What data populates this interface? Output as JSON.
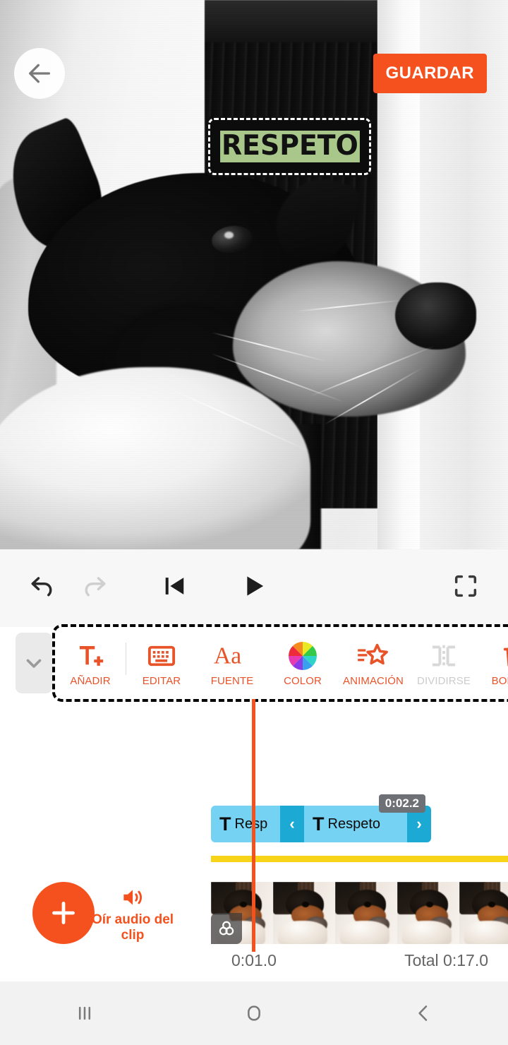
{
  "header": {
    "back_icon": "arrow-left-icon",
    "save_label": "GUARDAR"
  },
  "preview": {
    "overlay_text": "RESPETO",
    "overlay_text_color": "#111111",
    "overlay_highlight_color": "#a9c68b",
    "overlay_background_color": "#0c0c0c"
  },
  "playback": {
    "undo_icon": "undo-icon",
    "redo_icon": "redo-icon",
    "skip_start_icon": "skip-to-start-icon",
    "play_icon": "play-icon",
    "fullscreen_icon": "fullscreen-icon"
  },
  "toolbar": {
    "collapse_icon": "chevron-down-icon",
    "items": [
      {
        "label": "AÑADIR",
        "icon": "text-add-icon",
        "disabled": false
      },
      {
        "label": "EDITAR",
        "icon": "keyboard-icon",
        "disabled": false
      },
      {
        "label": "FUENTE",
        "icon": "font-aa-icon",
        "disabled": false
      },
      {
        "label": "COLOR",
        "icon": "color-wheel-icon",
        "disabled": false
      },
      {
        "label": "ANIMACIÓN",
        "icon": "star-motion-icon",
        "disabled": false
      },
      {
        "label": "DIVIDIRSE",
        "icon": "split-icon",
        "disabled": true
      },
      {
        "label": "BORRAR",
        "icon": "trash-icon",
        "disabled": false
      }
    ]
  },
  "timeline": {
    "text_clips": [
      {
        "t_icon": "text-T-icon",
        "name": "Resp"
      },
      {
        "t_icon": "text-T-icon",
        "name": "Respeto",
        "duration": "0:02.2",
        "selected": true
      }
    ],
    "handle_left_icon": "chevron-left-icon",
    "handle_right_icon": "chevron-right-icon",
    "filter_badge_icon": "color-filter-icon",
    "current_time": "0:01.0",
    "total_time": "Total 0:17.0",
    "clip_color": "#76d2f2",
    "handle_color": "#1ca9d4",
    "audio_bar_color": "#f7d417",
    "playhead_color": "#f4511e"
  },
  "media": {
    "add_icon": "plus-icon",
    "audio_icon": "speaker-icon",
    "audio_label": "Oír audio del clip"
  },
  "navbar": {
    "recents_icon": "recents-icon",
    "home_icon": "home-icon",
    "back_icon": "back-chevron-icon"
  },
  "colors": {
    "accent": "#f4511e",
    "tool_label": "#e8532a",
    "disabled": "#cccccc"
  }
}
